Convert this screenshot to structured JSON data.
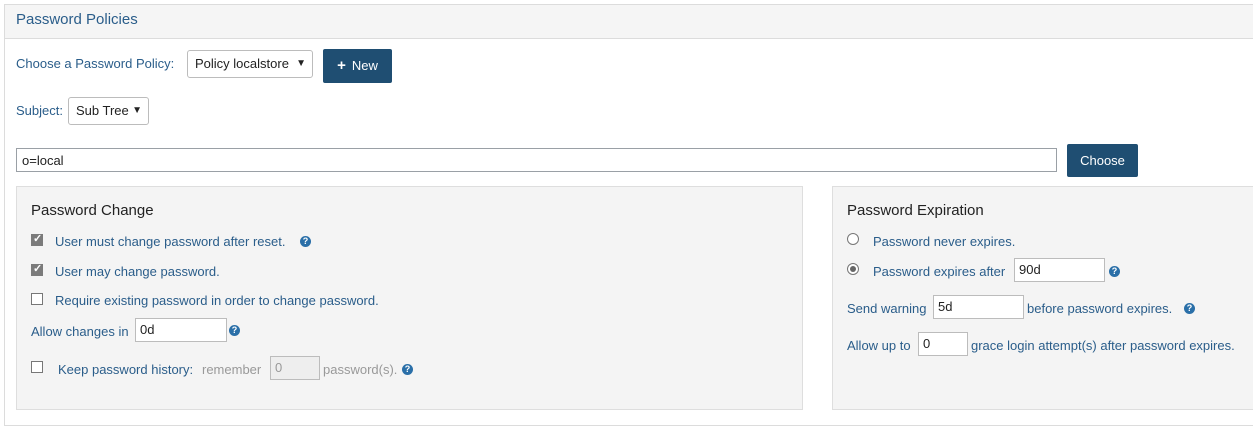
{
  "header": {
    "title": "Password Policies"
  },
  "policy": {
    "label": "Choose a Password Policy:",
    "selected": "Policy localstore",
    "new_button": "New"
  },
  "subject": {
    "label": "Subject:",
    "selected": "Sub Tree"
  },
  "dn": {
    "value": "o=local",
    "choose_button": "Choose"
  },
  "password_change": {
    "title": "Password Change",
    "must_change_after_reset": {
      "label": "User must change password after reset.",
      "checked": true
    },
    "may_change": {
      "label": "User may change password.",
      "checked": true
    },
    "require_existing": {
      "label": "Require existing password in order to change password.",
      "checked": false
    },
    "allow_changes": {
      "label": "Allow changes in",
      "value": "0d"
    },
    "history": {
      "label": "Keep password history:",
      "remember_label": "remember",
      "value": "0",
      "suffix": "password(s).",
      "checked": false
    }
  },
  "password_expiration": {
    "title": "Password Expiration",
    "never_expires": {
      "label": "Password never expires.",
      "selected": false
    },
    "expires_after": {
      "label": "Password expires after",
      "value": "90d",
      "selected": true
    },
    "send_warning": {
      "label": "Send warning",
      "value": "5d",
      "suffix": "before password expires."
    },
    "grace": {
      "label": "Allow up to",
      "value": "0",
      "suffix": "grace login attempt(s) after password expires."
    }
  },
  "icons": {
    "help": "help-icon",
    "plus": "plus-icon",
    "chevron": "chevron-down-icon"
  },
  "colors": {
    "accent": "#1f4e72",
    "label_text": "#2a5d8a",
    "panel_bg": "#f4f4f4"
  }
}
